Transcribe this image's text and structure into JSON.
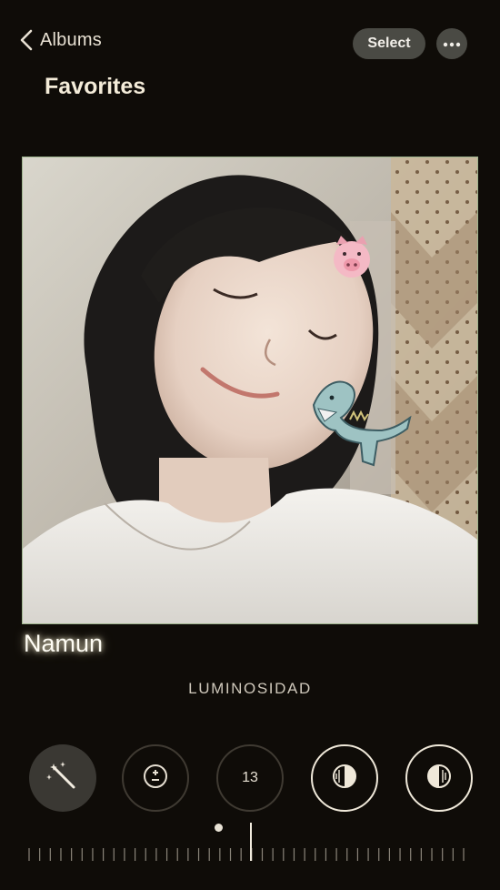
{
  "nav": {
    "back_label": "Albums",
    "select_label": "Select",
    "title": "Favorites"
  },
  "photo": {
    "caption": "Namun",
    "stickers": [
      "pig-emoji",
      "dinosaur-sticker"
    ]
  },
  "editor": {
    "adjustment_label": "LUMINOSIDAD",
    "tools": [
      {
        "name": "auto-enhance",
        "icon": "magic-wand-icon"
      },
      {
        "name": "exposure",
        "icon": "plus-minus-icon"
      },
      {
        "name": "brilliance",
        "value": "13"
      },
      {
        "name": "highlights",
        "icon": "half-circle-icon"
      },
      {
        "name": "shadows",
        "icon": "half-circle-icon"
      }
    ]
  },
  "colors": {
    "background": "#0f0c08",
    "pill": "#4a4a44",
    "frame_border": "#9fb58f",
    "text": "#efe7d8"
  }
}
